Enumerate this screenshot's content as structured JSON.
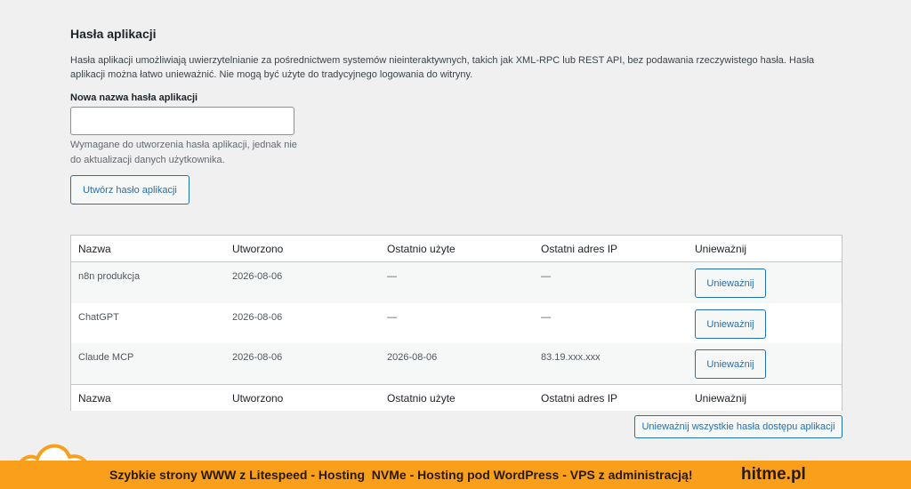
{
  "section": {
    "title": "Hasła aplikacji",
    "description": "Hasła aplikacji umożliwiają uwierzytelnianie za pośrednictwem systemów nieinteraktywnych, takich jak XML-RPC lub REST API, bez podawania rzeczywistego hasła. Hasła aplikacji można łatwo unieważnić. Nie mogą być użyte do tradycyjnego logowania do witryny."
  },
  "form": {
    "field_label": "Nowa nazwa hasła aplikacji",
    "field_value": "",
    "hint": "Wymagane do utworzenia hasła aplikacji, jednak nie do aktualizacji danych użytkownika.",
    "create_button": "Utwórz hasło aplikacji"
  },
  "table": {
    "columns": [
      "Nazwa",
      "Utworzono",
      "Ostatnio użyte",
      "Ostatni adres IP",
      "Unieważnij"
    ],
    "rows": [
      {
        "name": "n8n produkcja",
        "created": "2026-08-06",
        "last_used": "—",
        "last_ip": "—",
        "revoke_label": "Unieważnij"
      },
      {
        "name": "ChatGPT",
        "created": "2026-08-06",
        "last_used": "—",
        "last_ip": "—",
        "revoke_label": "Unieważnij"
      },
      {
        "name": "Claude MCP",
        "created": "2026-08-06",
        "last_used": "2026-08-06",
        "last_ip": "83.19.xxx.xxx",
        "revoke_label": "Unieważnij"
      }
    ],
    "revoke_all_button": "Unieważnij wszystkie hasła dostępu aplikacji"
  },
  "banner": {
    "text": "Szybkie strony WWW z Litespeed - Hosting  NVMe - Hosting pod WordPress - VPS z administracją!",
    "brand": "hitme.pl",
    "icon": "cloud-icon"
  },
  "colors": {
    "accent": "#2271b1",
    "banner": "#f99f1c",
    "background": "#f0f0f1"
  }
}
